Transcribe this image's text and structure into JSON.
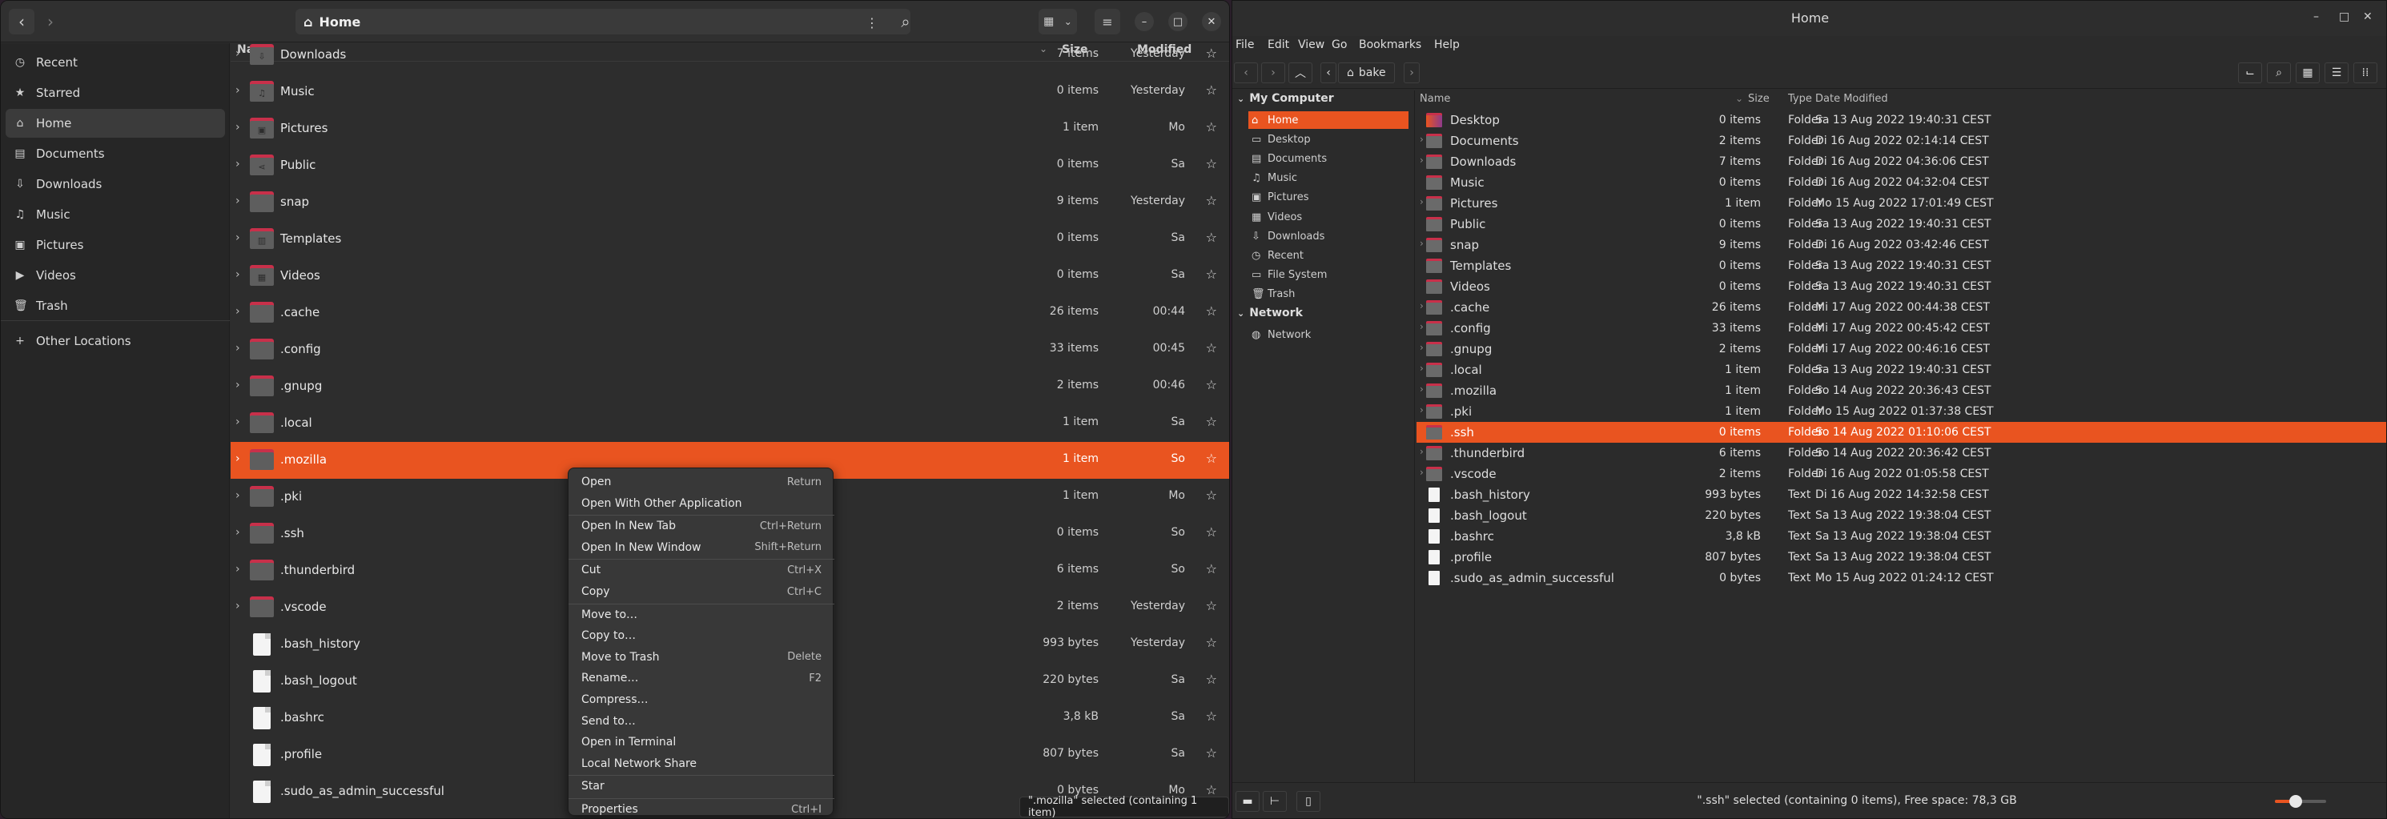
{
  "left_window": {
    "title": "Home",
    "sidebar": [
      {
        "icon": "clock-icon",
        "glyph": "◷",
        "label": "Recent"
      },
      {
        "icon": "star-icon",
        "glyph": "★",
        "label": "Starred"
      },
      {
        "icon": "home-icon",
        "glyph": "⌂",
        "label": "Home"
      },
      {
        "icon": "documents-icon",
        "glyph": "▤",
        "label": "Documents"
      },
      {
        "icon": "downloads-icon",
        "glyph": "⇩",
        "label": "Downloads"
      },
      {
        "icon": "music-icon",
        "glyph": "♫",
        "label": "Music"
      },
      {
        "icon": "pictures-icon",
        "glyph": "▣",
        "label": "Pictures"
      },
      {
        "icon": "videos-icon",
        "glyph": "▶",
        "label": "Videos"
      },
      {
        "icon": "trash-icon",
        "glyph": "🗑",
        "label": "Trash"
      },
      {
        "icon": "plus-icon",
        "glyph": "+",
        "label": "Other Locations"
      }
    ],
    "columns": {
      "name": "Name",
      "size": "Size",
      "modified": "Modified"
    },
    "rows": [
      {
        "name": "Downloads",
        "size": "7 items",
        "modified": "Yesterday",
        "kind": "folder",
        "emblem": "⇩"
      },
      {
        "name": "Music",
        "size": "0 items",
        "modified": "Yesterday",
        "kind": "folder",
        "emblem": "♫"
      },
      {
        "name": "Pictures",
        "size": "1 item",
        "modified": "Mo",
        "kind": "folder",
        "emblem": "▣"
      },
      {
        "name": "Public",
        "size": "0 items",
        "modified": "Sa",
        "kind": "folder",
        "emblem": "⋖"
      },
      {
        "name": "snap",
        "size": "9 items",
        "modified": "Yesterday",
        "kind": "folder",
        "emblem": ""
      },
      {
        "name": "Templates",
        "size": "0 items",
        "modified": "Sa",
        "kind": "folder",
        "emblem": "▥"
      },
      {
        "name": "Videos",
        "size": "0 items",
        "modified": "Sa",
        "kind": "folder",
        "emblem": "▦"
      },
      {
        "name": ".cache",
        "size": "26 items",
        "modified": "00:44",
        "kind": "folder",
        "emblem": ""
      },
      {
        "name": ".config",
        "size": "33 items",
        "modified": "00:45",
        "kind": "folder",
        "emblem": ""
      },
      {
        "name": ".gnupg",
        "size": "2 items",
        "modified": "00:46",
        "kind": "folder",
        "emblem": ""
      },
      {
        "name": ".local",
        "size": "1 item",
        "modified": "Sa",
        "kind": "folder",
        "emblem": ""
      },
      {
        "name": ".mozilla",
        "size": "1 item",
        "modified": "So",
        "kind": "folder",
        "emblem": "",
        "selected": true
      },
      {
        "name": ".pki",
        "size": "1 item",
        "modified": "Mo",
        "kind": "folder",
        "emblem": ""
      },
      {
        "name": ".ssh",
        "size": "0 items",
        "modified": "So",
        "kind": "folder",
        "emblem": ""
      },
      {
        "name": ".thunderbird",
        "size": "6 items",
        "modified": "So",
        "kind": "folder",
        "emblem": ""
      },
      {
        "name": ".vscode",
        "size": "2 items",
        "modified": "Yesterday",
        "kind": "folder",
        "emblem": ""
      },
      {
        "name": ".bash_history",
        "size": "993 bytes",
        "modified": "Yesterday",
        "kind": "file",
        "emblem": ""
      },
      {
        "name": ".bash_logout",
        "size": "220 bytes",
        "modified": "Sa",
        "kind": "file",
        "emblem": ""
      },
      {
        "name": ".bashrc",
        "size": "3,8 kB",
        "modified": "Sa",
        "kind": "file",
        "emblem": ""
      },
      {
        "name": ".profile",
        "size": "807 bytes",
        "modified": "Sa",
        "kind": "file",
        "emblem": ""
      },
      {
        "name": ".sudo_as_admin_successful",
        "size": "0 bytes",
        "modified": "Mo",
        "kind": "file",
        "emblem": ""
      }
    ],
    "status": "\".mozilla\" selected  (containing 1 item)",
    "context_menu": [
      {
        "label": "Open",
        "accel": "Return"
      },
      {
        "label": "Open With Other Application",
        "accel": ""
      },
      {
        "sep": true
      },
      {
        "label": "Open In New Tab",
        "accel": "Ctrl+Return"
      },
      {
        "label": "Open In New Window",
        "accel": "Shift+Return"
      },
      {
        "sep": true
      },
      {
        "label": "Cut",
        "accel": "Ctrl+X"
      },
      {
        "label": "Copy",
        "accel": "Ctrl+C"
      },
      {
        "sep": true
      },
      {
        "label": "Move to…",
        "accel": ""
      },
      {
        "label": "Copy to…",
        "accel": ""
      },
      {
        "label": "Move to Trash",
        "accel": "Delete"
      },
      {
        "label": "Rename…",
        "accel": "F2"
      },
      {
        "label": "Compress…",
        "accel": ""
      },
      {
        "label": "Send to…",
        "accel": ""
      },
      {
        "label": "Open in Terminal",
        "accel": ""
      },
      {
        "label": "Local Network Share",
        "accel": ""
      },
      {
        "sep": true
      },
      {
        "label": "Star",
        "accel": ""
      },
      {
        "sep": true
      },
      {
        "label": "Properties",
        "accel": "Ctrl+I"
      }
    ]
  },
  "right_window": {
    "title": "Home",
    "menu": [
      "File",
      "Edit",
      "View",
      "Go",
      "Bookmarks",
      "Help"
    ],
    "breadcrumb": "bake",
    "sidebar_sections": [
      {
        "header": "My Computer",
        "items": [
          {
            "icon": "home-icon",
            "glyph": "⌂",
            "label": "Home",
            "active": true
          },
          {
            "icon": "desktop-icon",
            "glyph": "▭",
            "label": "Desktop"
          },
          {
            "icon": "documents-icon",
            "glyph": "▤",
            "label": "Documents"
          },
          {
            "icon": "music-icon",
            "glyph": "♫",
            "label": "Music"
          },
          {
            "icon": "pictures-icon",
            "glyph": "▣",
            "label": "Pictures"
          },
          {
            "icon": "videos-icon",
            "glyph": "▦",
            "label": "Videos"
          },
          {
            "icon": "downloads-icon",
            "glyph": "⇩",
            "label": "Downloads"
          },
          {
            "icon": "recent-icon",
            "glyph": "◷",
            "label": "Recent"
          },
          {
            "icon": "filesystem-icon",
            "glyph": "▭",
            "label": "File System"
          },
          {
            "icon": "trash-icon",
            "glyph": "🗑",
            "label": "Trash"
          }
        ]
      },
      {
        "header": "Network",
        "items": [
          {
            "icon": "network-icon",
            "glyph": "◍",
            "label": "Network"
          }
        ]
      }
    ],
    "columns": {
      "name": "Name",
      "size": "Size",
      "type": "Type",
      "date": "Date Modified"
    },
    "rows": [
      {
        "name": "Desktop",
        "size": "0 items",
        "type": "Folder",
        "date": "Sa 13 Aug 2022 19:40:31 CEST",
        "kind": "desktop",
        "exp": false
      },
      {
        "name": "Documents",
        "size": "2 items",
        "type": "Folder",
        "date": "Di 16 Aug 2022 02:14:14 CEST",
        "kind": "folder",
        "exp": true
      },
      {
        "name": "Downloads",
        "size": "7 items",
        "type": "Folder",
        "date": "Di 16 Aug 2022 04:36:06 CEST",
        "kind": "folder",
        "exp": true
      },
      {
        "name": "Music",
        "size": "0 items",
        "type": "Folder",
        "date": "Di 16 Aug 2022 04:32:04 CEST",
        "kind": "folder",
        "exp": false
      },
      {
        "name": "Pictures",
        "size": "1 item",
        "type": "Folder",
        "date": "Mo 15 Aug 2022 17:01:49 CEST",
        "kind": "folder",
        "exp": true
      },
      {
        "name": "Public",
        "size": "0 items",
        "type": "Folder",
        "date": "Sa 13 Aug 2022 19:40:31 CEST",
        "kind": "folder",
        "exp": false
      },
      {
        "name": "snap",
        "size": "9 items",
        "type": "Folder",
        "date": "Di 16 Aug 2022 03:42:46 CEST",
        "kind": "folder",
        "exp": true
      },
      {
        "name": "Templates",
        "size": "0 items",
        "type": "Folder",
        "date": "Sa 13 Aug 2022 19:40:31 CEST",
        "kind": "folder",
        "exp": false
      },
      {
        "name": "Videos",
        "size": "0 items",
        "type": "Folder",
        "date": "Sa 13 Aug 2022 19:40:31 CEST",
        "kind": "folder",
        "exp": false
      },
      {
        "name": ".cache",
        "size": "26 items",
        "type": "Folder",
        "date": "Mi 17 Aug 2022 00:44:38 CEST",
        "kind": "folder",
        "exp": true
      },
      {
        "name": ".config",
        "size": "33 items",
        "type": "Folder",
        "date": "Mi 17 Aug 2022 00:45:42 CEST",
        "kind": "folder",
        "exp": true
      },
      {
        "name": ".gnupg",
        "size": "2 items",
        "type": "Folder",
        "date": "Mi 17 Aug 2022 00:46:16 CEST",
        "kind": "folder",
        "exp": true
      },
      {
        "name": ".local",
        "size": "1 item",
        "type": "Folder",
        "date": "Sa 13 Aug 2022 19:40:31 CEST",
        "kind": "folder",
        "exp": true
      },
      {
        "name": ".mozilla",
        "size": "1 item",
        "type": "Folder",
        "date": "So 14 Aug 2022 20:36:43 CEST",
        "kind": "folder",
        "exp": true
      },
      {
        "name": ".pki",
        "size": "1 item",
        "type": "Folder",
        "date": "Mo 15 Aug 2022 01:37:38 CEST",
        "kind": "folder",
        "exp": true
      },
      {
        "name": ".ssh",
        "size": "0 items",
        "type": "Folder",
        "date": "So 14 Aug 2022 01:10:06 CEST",
        "kind": "folder",
        "exp": false,
        "selected": true
      },
      {
        "name": ".thunderbird",
        "size": "6 items",
        "type": "Folder",
        "date": "So 14 Aug 2022 20:36:42 CEST",
        "kind": "folder",
        "exp": true
      },
      {
        "name": ".vscode",
        "size": "2 items",
        "type": "Folder",
        "date": "Di 16 Aug 2022 01:05:58 CEST",
        "kind": "folder",
        "exp": true
      },
      {
        "name": ".bash_history",
        "size": "993 bytes",
        "type": "Text",
        "date": "Di 16 Aug 2022 14:32:58 CEST",
        "kind": "file",
        "exp": false
      },
      {
        "name": ".bash_logout",
        "size": "220 bytes",
        "type": "Text",
        "date": "Sa 13 Aug 2022 19:38:04 CEST",
        "kind": "file",
        "exp": false
      },
      {
        "name": ".bashrc",
        "size": "3,8 kB",
        "type": "Text",
        "date": "Sa 13 Aug 2022 19:38:04 CEST",
        "kind": "file",
        "exp": false
      },
      {
        "name": ".profile",
        "size": "807 bytes",
        "type": "Text",
        "date": "Sa 13 Aug 2022 19:38:04 CEST",
        "kind": "file",
        "exp": false
      },
      {
        "name": ".sudo_as_admin_successful",
        "size": "0 bytes",
        "type": "Text",
        "date": "Mo 15 Aug 2022 01:24:12 CEST",
        "kind": "file",
        "exp": false
      }
    ],
    "status": "\".ssh\" selected (containing 0 items), Free space: 78,3 GB",
    "zoom_level": 0.4
  },
  "colors": {
    "accent": "#e95420",
    "folder_tab": "#c8304a"
  }
}
